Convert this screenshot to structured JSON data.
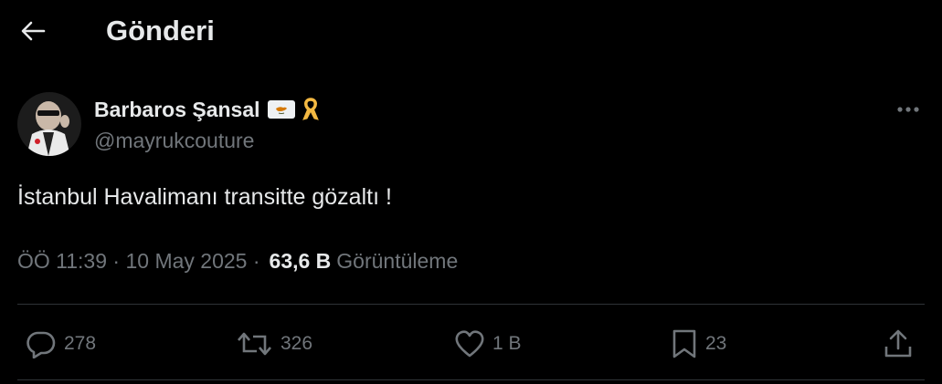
{
  "header": {
    "title": "Gönderi"
  },
  "author": {
    "display_name": "Barbaros Şansal",
    "handle": "@mayrukcouture"
  },
  "tweet": {
    "text": "İstanbul Havalimanı transitte gözaltı !",
    "time": "ÖÖ 11:39",
    "date": "10 May 2025",
    "views_count": "63,6 B",
    "views_label": "Görüntüleme"
  },
  "actions": {
    "replies": "278",
    "reposts": "326",
    "likes": "1 B",
    "bookmarks": "23"
  },
  "colors": {
    "background": "#000000",
    "text": "#e7e9ea",
    "secondary": "#71767b",
    "divider": "#2f3336",
    "ribbon": "#f4b942"
  }
}
